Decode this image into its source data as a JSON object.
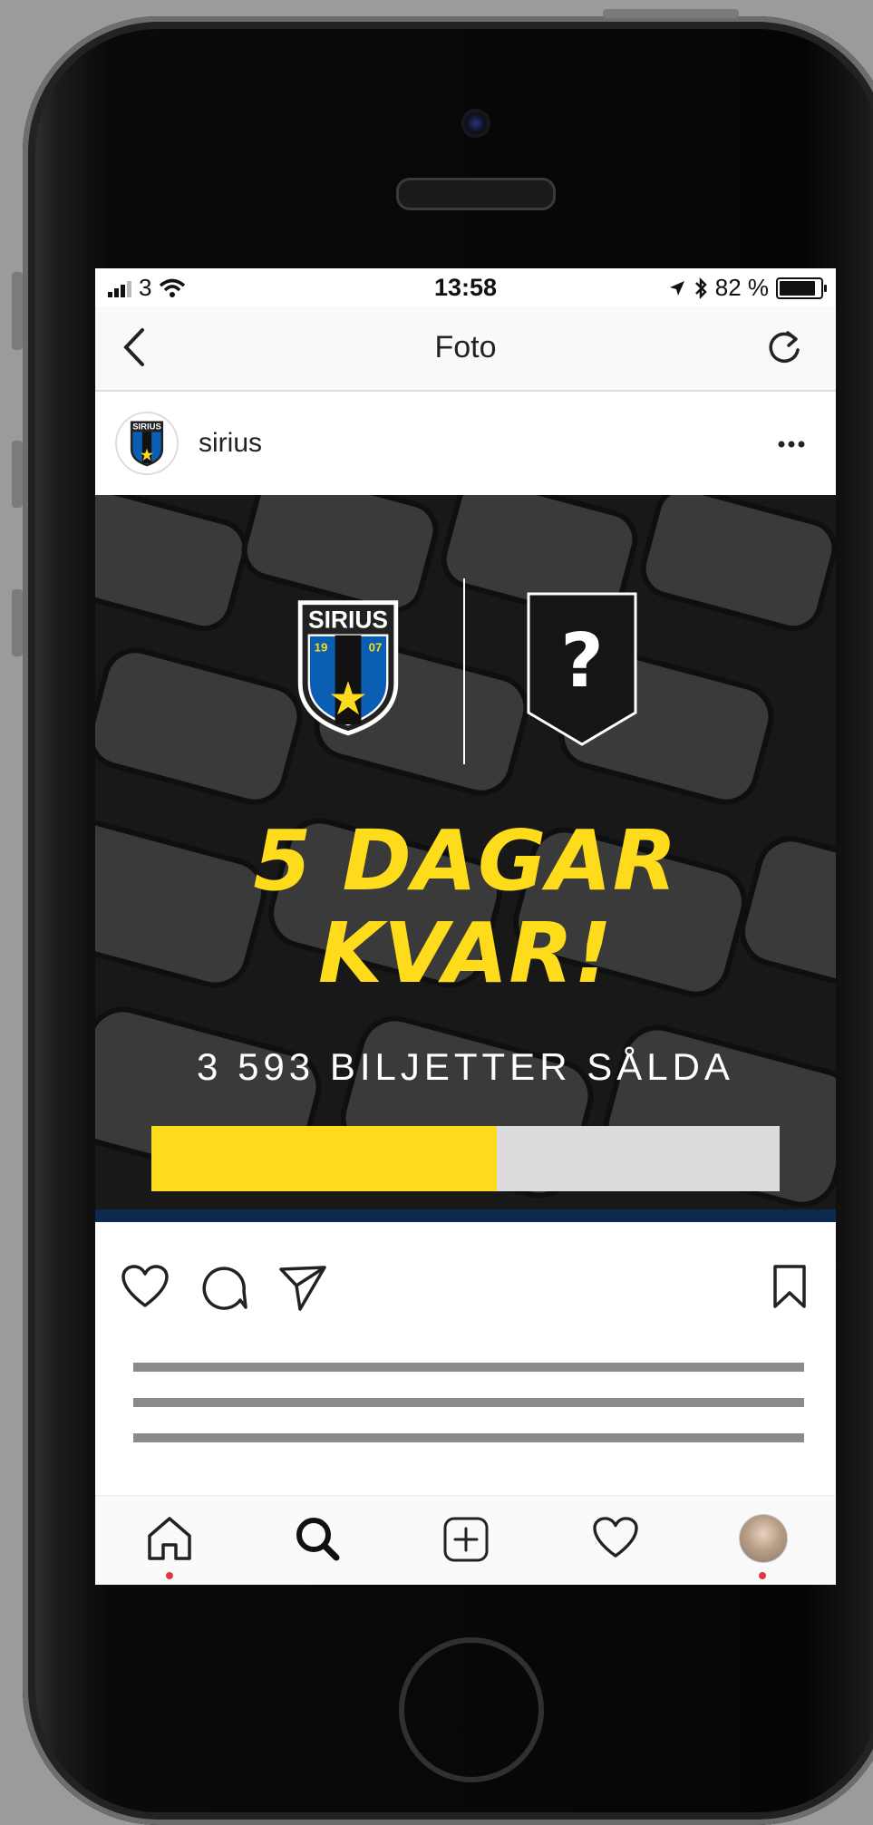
{
  "status_bar": {
    "carrier": "3",
    "time": "13:58",
    "battery": "82 %"
  },
  "nav": {
    "title": "Foto"
  },
  "post": {
    "username": "sirius",
    "headline_line1": "5 DAGAR",
    "headline_line2": "KVAR!",
    "tickets_sold": "3 593 BILJETTER SÅLDA",
    "progress_fraction": 0.55,
    "badge_placeholder": "?"
  },
  "logo": {
    "name": "SIRIUS",
    "year_left": "19",
    "year_right": "07"
  },
  "colors": {
    "accent_yellow": "#fedc1c",
    "club_blue": "#0a5fb4",
    "navy_strip": "#0b2a4e",
    "notification_dot": "#e0383e"
  },
  "icons": {
    "actions": [
      "heart-icon",
      "comment-icon",
      "share-icon",
      "bookmark-icon"
    ],
    "tabs": [
      "home-icon",
      "search-icon",
      "add-post-icon",
      "activity-heart-icon",
      "profile-avatar"
    ]
  }
}
